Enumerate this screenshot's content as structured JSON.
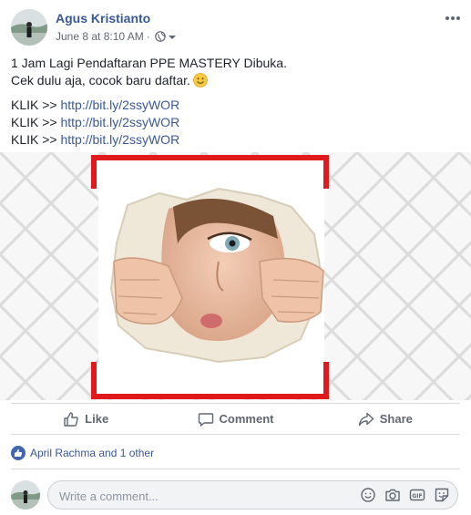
{
  "post": {
    "author": "Agus Kristianto",
    "timestamp": "June 8 at 8:10 AM",
    "separator": "·",
    "privacy_icon": "globe-icon",
    "text_line1": "1 Jam Lagi Pendaftaran PPE MASTERY Dibuka.",
    "text_line2": "Cek dulu aja, cocok baru daftar.",
    "emoji": "smile-emoji",
    "links": [
      {
        "prefix": "KLIK >> ",
        "url": "http://bit.ly/2ssyWOR"
      },
      {
        "prefix": "KLIK >> ",
        "url": "http://bit.ly/2ssyWOR"
      },
      {
        "prefix": "KLIK >> ",
        "url": "http://bit.ly/2ssyWOR"
      }
    ]
  },
  "actions": {
    "like": "Like",
    "comment": "Comment",
    "share": "Share"
  },
  "reactions": {
    "text": "April Rachma and 1 other"
  },
  "comment": {
    "placeholder": "Write a comment..."
  },
  "colors": {
    "link": "#385898",
    "accent": "#4267b2",
    "frame_red": "#e0191d"
  }
}
